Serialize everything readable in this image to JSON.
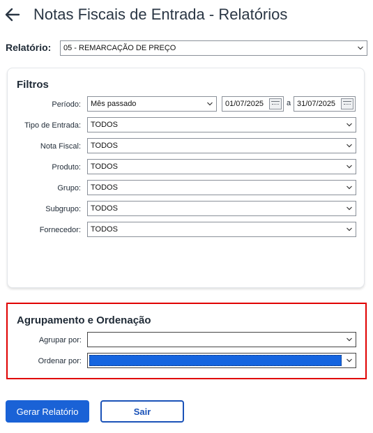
{
  "header": {
    "title": "Notas Fiscais de Entrada - Relatórios"
  },
  "report": {
    "label": "Relatório:",
    "value": "05 - REMARCAÇÃO DE PREÇO"
  },
  "filters": {
    "title": "Filtros",
    "period": {
      "label": "Período:",
      "value": "Mês passado",
      "date_from": "01/07/2025",
      "separator": "a",
      "date_to": "31/07/2025"
    },
    "tipo_entrada": {
      "label": "Tipo de Entrada:",
      "value": "TODOS"
    },
    "nota_fiscal": {
      "label": "Nota Fiscal:",
      "value": "TODOS"
    },
    "produto": {
      "label": "Produto:",
      "value": "TODOS"
    },
    "grupo": {
      "label": "Grupo:",
      "value": "TODOS"
    },
    "subgrupo": {
      "label": "Subgrupo:",
      "value": "TODOS"
    },
    "fornecedor": {
      "label": "Fornecedor:",
      "value": "TODOS"
    }
  },
  "grouping": {
    "title": "Agrupamento e Ordenação",
    "group_by": {
      "label": "Agrupar por:",
      "value": ""
    },
    "order_by": {
      "label": "Ordenar por:",
      "value": ""
    }
  },
  "actions": {
    "generate_label": "Gerar Relatório",
    "exit_label": "Sair"
  },
  "colors": {
    "primary": "#1a62d6",
    "highlight_border": "#e00000",
    "selection": "#1565e0"
  }
}
